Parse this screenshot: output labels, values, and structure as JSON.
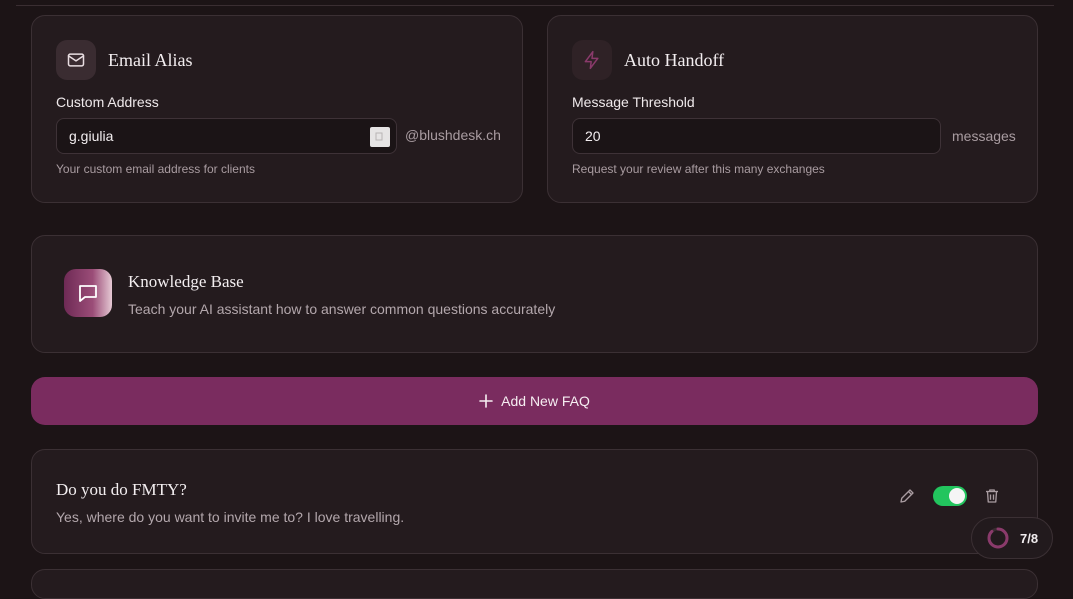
{
  "email_alias": {
    "title": "Email Alias",
    "icon": "mail-icon",
    "field_label": "Custom Address",
    "value": "g.giulia",
    "domain_suffix": "@blushdesk.ch",
    "helper": "Your custom email address for clients"
  },
  "auto_handoff": {
    "title": "Auto Handoff",
    "icon": "lightning-icon",
    "field_label": "Message Threshold",
    "value": "20",
    "unit": "messages",
    "helper": "Request your review after this many exchanges"
  },
  "knowledge_base": {
    "title": "Knowledge Base",
    "icon": "chat-bubble-icon",
    "description": "Teach your AI assistant how to answer common questions accurately"
  },
  "add_faq": {
    "label": "Add New FAQ",
    "icon": "plus-icon"
  },
  "faqs": [
    {
      "question": "Do you do FMTY?",
      "answer": "Yes, where do you want to invite me to? I love travelling.",
      "enabled": true
    }
  ],
  "progress": {
    "label": "7/8",
    "completed": 7,
    "total": 8
  },
  "colors": {
    "accent": "#7a2c5f",
    "toggle_on": "#22c55e",
    "background": "#1c1416",
    "card": "#241b1e"
  }
}
